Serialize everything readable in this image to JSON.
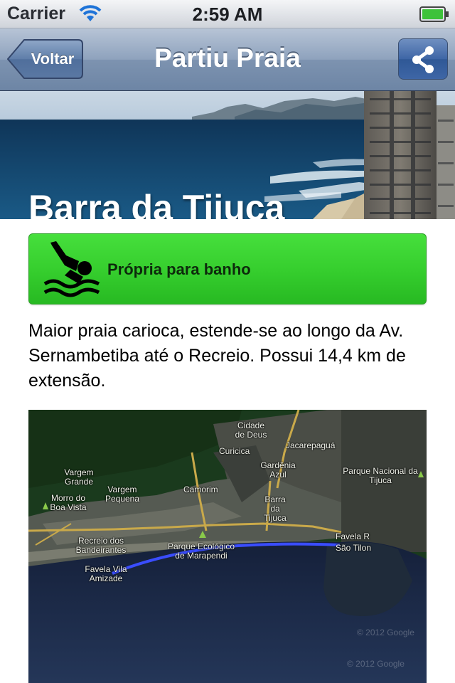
{
  "status_bar": {
    "carrier": "Carrier",
    "time": "2:59 AM",
    "wifi_icon": "wifi-icon",
    "battery_icon": "battery-full-icon"
  },
  "nav": {
    "back_label": "Voltar",
    "title": "Partiu Praia",
    "share_icon": "share-icon"
  },
  "beach": {
    "name": "Barra da Tijuca",
    "status": {
      "label": "Própria para banho",
      "icon": "swimmer-icon",
      "color": "#3fd736"
    },
    "description": "Maior praia carioca, estende-se ao longo da Av. Sernambetiba até o Recreio. Possui 14,4 km de extensão."
  },
  "map": {
    "labels": [
      "Cidade de Deus",
      "Curicica",
      "Jacarepaguá",
      "Gardênia Azul",
      "Vargem Grande",
      "Parque Nacional da Tijuca",
      "Morro do Boa Vista",
      "Vargem Pequena",
      "Camorim",
      "Barra da Tijuca",
      "Recreio dos Bandeirantes",
      "Parque Ecológico de Marapendi",
      "Favela R",
      "São Tilon",
      "Favela Vila Amizade"
    ],
    "copyright": "© 2012 Google",
    "route_color": "#3a4dff"
  }
}
